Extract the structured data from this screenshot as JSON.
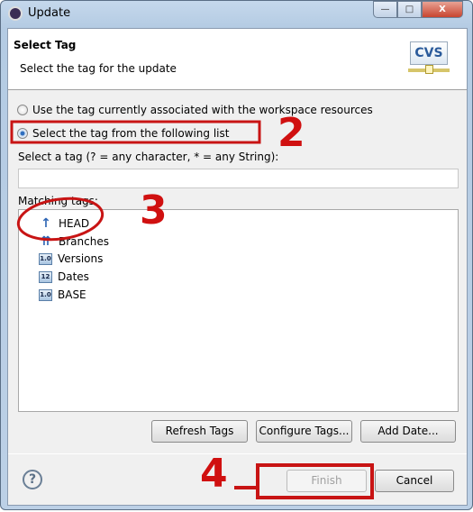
{
  "window": {
    "title": "Update",
    "minimize": "—",
    "maximize": "□",
    "close": "X"
  },
  "header": {
    "title": "Select Tag",
    "description": "Select the tag for the update",
    "logo": "CVS"
  },
  "options": {
    "radio1": {
      "label": "Use the tag currently associated with the workspace resources",
      "checked": false
    },
    "radio2": {
      "label": "Select the tag from the following list",
      "checked": true
    }
  },
  "filter": {
    "label": "Select a tag (? = any character, * = any String):",
    "value": ""
  },
  "matching": {
    "label": "Matching tags:",
    "items": [
      {
        "label": "HEAD",
        "icon": "head-arrow-icon"
      },
      {
        "label": "Branches",
        "icon": "branches-icon"
      },
      {
        "label": "Versions",
        "icon": "versions-icon"
      },
      {
        "label": "Dates",
        "icon": "dates-icon"
      },
      {
        "label": "BASE",
        "icon": "base-icon"
      }
    ]
  },
  "buttons": {
    "refresh": "Refresh Tags",
    "configure": "Configure Tags...",
    "add_date": "Add Date...",
    "finish": "Finish",
    "cancel": "Cancel",
    "help": "?"
  },
  "annotations": {
    "n2": "2",
    "n3": "3",
    "n4": "4",
    "color": "#d01010"
  }
}
